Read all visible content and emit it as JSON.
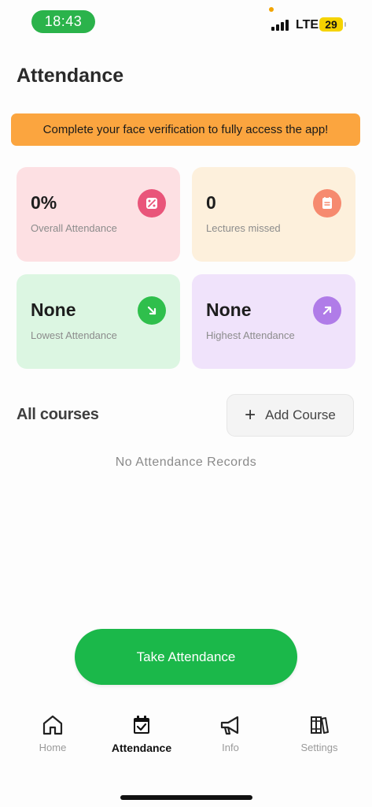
{
  "status_bar": {
    "time": "18:43",
    "network": "LTE",
    "battery": "29"
  },
  "header": {
    "title": "Attendance"
  },
  "banner": {
    "text": "Complete your face verification to fully access the app!"
  },
  "stats": {
    "overall": {
      "value": "0%",
      "label": "Overall Attendance",
      "icon": "percent-icon"
    },
    "missed": {
      "value": "0",
      "label": "Lectures missed",
      "icon": "note-icon"
    },
    "lowest": {
      "value": "None",
      "label": "Lowest Attendance",
      "icon": "arrow-down-right-icon"
    },
    "highest": {
      "value": "None",
      "label": "Highest Attendance",
      "icon": "arrow-up-right-icon"
    }
  },
  "courses": {
    "title": "All courses",
    "add_label": "Add Course",
    "empty_text": "No Attendance Records"
  },
  "actions": {
    "take_attendance": "Take Attendance"
  },
  "nav": {
    "items": [
      {
        "label": "Home",
        "icon": "home-icon",
        "active": false
      },
      {
        "label": "Attendance",
        "icon": "calendar-check-icon",
        "active": true
      },
      {
        "label": "Info",
        "icon": "megaphone-icon",
        "active": false
      },
      {
        "label": "Settings",
        "icon": "books-icon",
        "active": false
      }
    ]
  },
  "colors": {
    "primary_green": "#1bb84a",
    "banner_orange": "#fba53f",
    "overall_bg": "#fde0e3",
    "missed_bg": "#fdf0dc",
    "lowest_bg": "#dcf6e2",
    "highest_bg": "#f0e3fb"
  }
}
